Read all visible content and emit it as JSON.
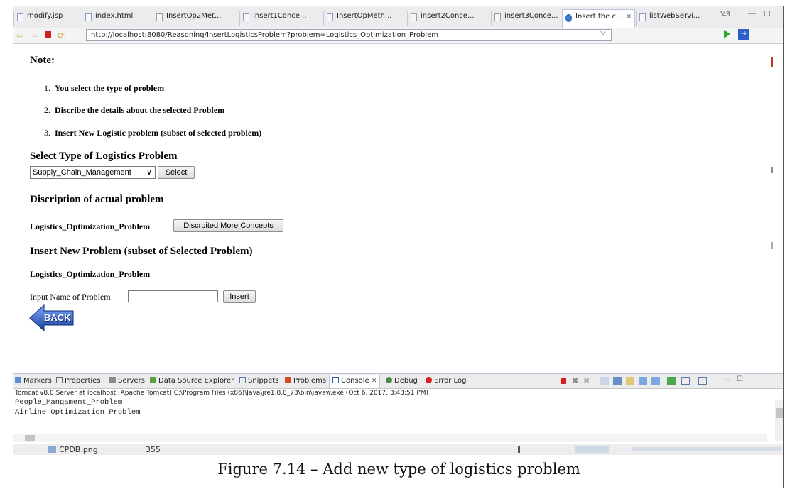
{
  "tabs": [
    {
      "label": "modify.jsp"
    },
    {
      "label": "index.html"
    },
    {
      "label": "InsertOp2Met..."
    },
    {
      "label": "insert1Conce..."
    },
    {
      "label": "InsertOpMeth..."
    },
    {
      "label": "insert2Conce..."
    },
    {
      "label": "insert3Conce..."
    },
    {
      "label": "Insert the c...",
      "close": "✕"
    },
    {
      "label": "listWebServi..."
    }
  ],
  "tab_overflow": "\"43",
  "address": {
    "url": "http://localhost:8080/Reasoning/InsertLogisticsProblem?problem=Logistics_Optimization_Problem"
  },
  "page": {
    "note_heading": "Note:",
    "steps": [
      {
        "num": "1.",
        "text": "You select the type of problem"
      },
      {
        "num": "2.",
        "text": "Discribe the details about the selected Problem"
      },
      {
        "num": "3.",
        "text": "Insert New Logistic problem (subset of selected problem)"
      }
    ],
    "select_heading": "Select Type of Logistics Problem",
    "select_value": "Supply_Chain_Management",
    "select_button": "Select",
    "discription_heading": "Discription of actual problem",
    "actual_problem": "Logistics_Optimization_Problem",
    "concepts_button": "Discrpited More Concepts",
    "insert_heading": "Insert New Problem (subset of Selected Problem)",
    "selected_problem": "Logistics_Optimization_Problem",
    "input_label": "Input Name of Problem",
    "input_value": "",
    "insert_button": "Insert",
    "back_label": "BACK"
  },
  "console": {
    "tabs": [
      {
        "label": "Markers"
      },
      {
        "label": "Properties"
      },
      {
        "label": "Servers"
      },
      {
        "label": "Data Source Explorer"
      },
      {
        "label": "Snippets"
      },
      {
        "label": "Problems"
      },
      {
        "label": "Console",
        "close": "✕"
      },
      {
        "label": "Debug"
      },
      {
        "label": "Error Log"
      }
    ],
    "description": "Tomcat v8.0 Server at localhost [Apache Tomcat] C:\\Program Files (x86)\\Java\\jre1.8.0_73\\bin\\javaw.exe (Oct 6, 2017, 3:43:51 PM)",
    "lines": [
      "People_Mangament_Problem",
      "Airline_Optimization_Problem"
    ]
  },
  "bottom": {
    "file": "CPDB.png",
    "size": "355"
  },
  "caption": "Figure 7.14 – Add new type of logistics problem",
  "colors": {
    "accent": "#3b7ad6",
    "back_arrow": "#1f4fb0",
    "stop": "#d62020",
    "run": "#2aa52a"
  }
}
